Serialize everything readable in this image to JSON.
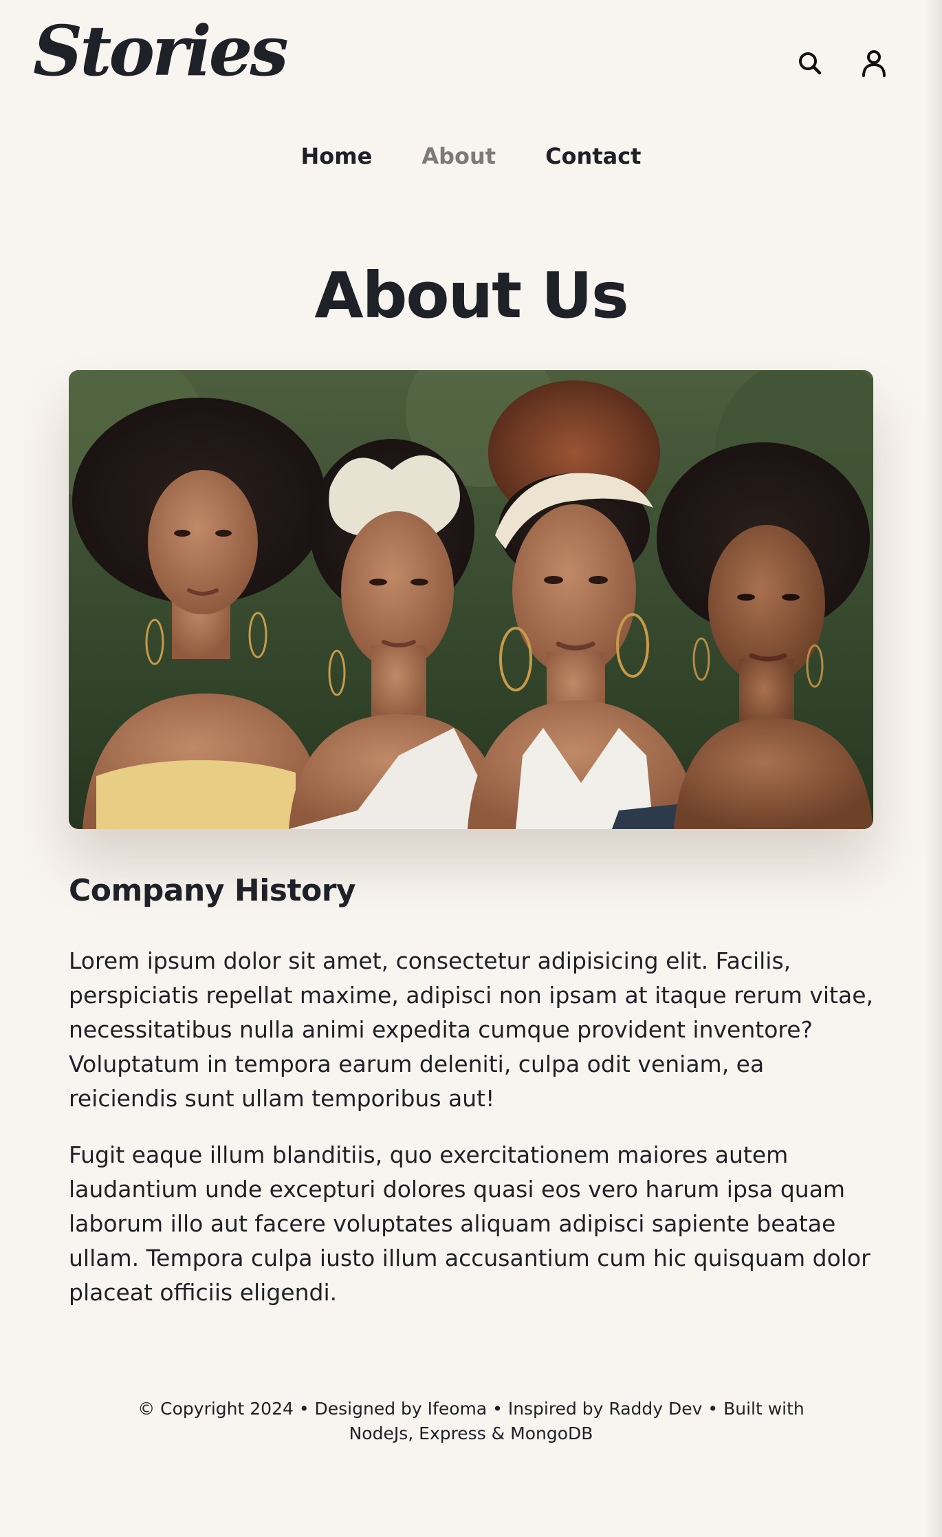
{
  "header": {
    "logo": "Stories",
    "icons": [
      "search-icon",
      "user-icon"
    ]
  },
  "nav": {
    "items": [
      {
        "label": "Home",
        "active": false
      },
      {
        "label": "About",
        "active": true
      },
      {
        "label": "Contact",
        "active": false
      }
    ]
  },
  "main": {
    "title": "About Us",
    "hero_image_description_name": "hero-photo",
    "section_title": "Company History",
    "paragraphs": [
      "Lorem ipsum dolor sit amet, consectetur adipisicing elit. Facilis, perspiciatis repellat maxime, adipisci non ipsam at itaque rerum vitae, necessitatibus nulla animi expedita cumque provident inventore? Voluptatum in tempora earum deleniti, culpa odit veniam, ea reiciendis sunt ullam temporibus aut!",
      "Fugit eaque illum blanditiis, quo exercitationem maiores autem laudantium unde excepturi dolores quasi eos vero harum ipsa quam laborum illo aut facere voluptates aliquam adipisci sapiente beatae ullam. Tempora culpa iusto illum accusantium cum hic quisquam dolor placeat officiis eligendi."
    ]
  },
  "footer": {
    "text": "© Copyright 2024 • Designed by Ifeoma • Inspired by Raddy Dev • Built with NodeJs, Express & MongoDB"
  },
  "colors": {
    "background": "#f8f4ef",
    "text": "#1f2128",
    "nav_active": "#7b7b7b"
  }
}
